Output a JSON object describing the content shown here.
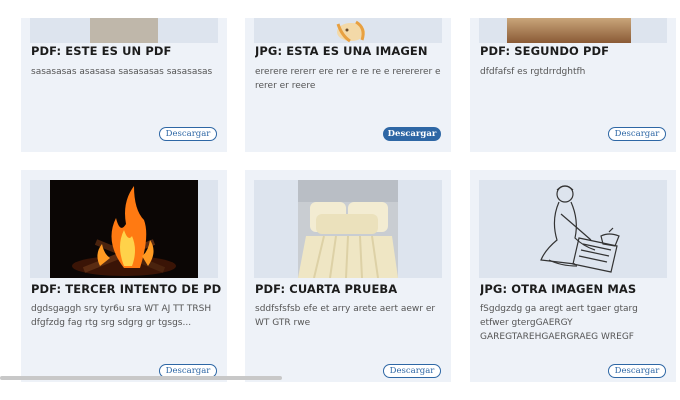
{
  "cards": [
    {
      "title": "PDF: ESTE ES UN PDF",
      "desc": "sasasasas asasasa sasasasas sasasasas",
      "button": "Descargar"
    },
    {
      "title": "JPG: ESTA ES UNA IMAGEN",
      "desc": "ererere rererr ere rer e re re e rerererer e rerer er reere",
      "button": "Descargar"
    },
    {
      "title": "PDF: SEGUNDO PDF",
      "desc": "dfdfafsf es rgtdrrdghtfh",
      "button": "Descargar"
    },
    {
      "title": "PDF: TERCER INTENTO DE PDF",
      "desc": "dgdsgaggh sry tyr6u sra WT AJ TT TRSH dfgfzdg fag rtg srg sdgrg gr tgsgs...",
      "button": "Descargar"
    },
    {
      "title": "PDF: CUARTA PRUEBA",
      "desc": "sddfsfsfsb efe et arry arete aert aewr er WT GTR rwe",
      "button": "Descargar"
    },
    {
      "title": "JPG: OTRA IMAGEN MAS",
      "desc": "fSgdgzdg ga aregt aert tgaer gtarg etfwer gtergGAERGY GAREGTAREHGAERGRAEG WREGF",
      "button": "Descargar"
    }
  ],
  "images": [
    {
      "icon": "pdf-thumbnail-image"
    },
    {
      "icon": "cartoon-dog-image"
    },
    {
      "icon": "wood-table-image"
    },
    {
      "icon": "campfire-image"
    },
    {
      "icon": "bedding-image"
    },
    {
      "icon": "woman-sketch-image"
    }
  ],
  "colors": {
    "accent": "#2e67a5",
    "card_bg": "#eef2f8",
    "image_bg": "#dde4ee"
  }
}
